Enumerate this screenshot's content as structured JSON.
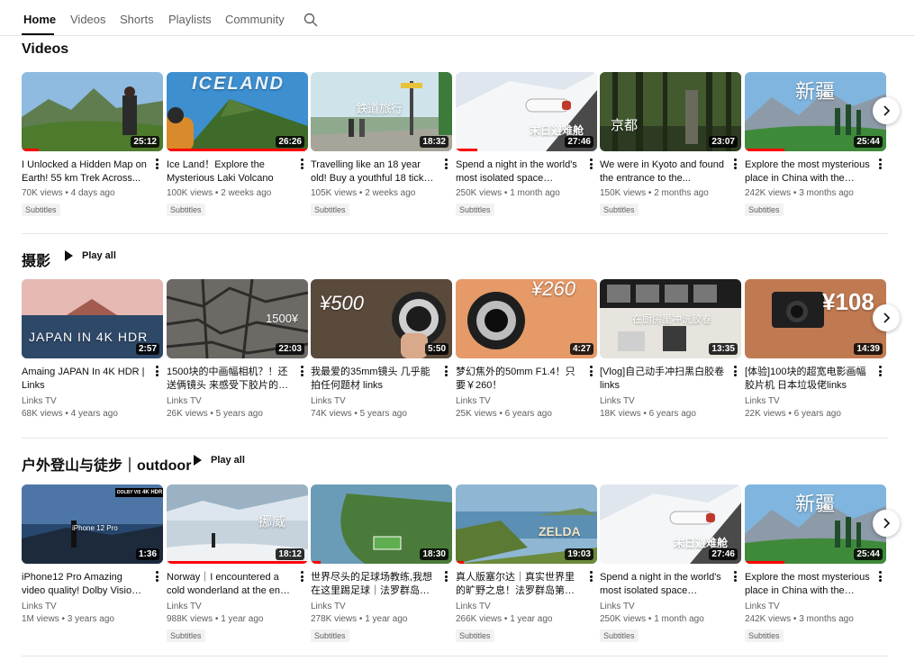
{
  "tabs": [
    {
      "label": "Home",
      "active": true
    },
    {
      "label": "Videos",
      "active": false
    },
    {
      "label": "Shorts",
      "active": false
    },
    {
      "label": "Playlists",
      "active": false
    },
    {
      "label": "Community",
      "active": false
    }
  ],
  "colors": {
    "progress": "#ff0000",
    "text_secondary": "#606060",
    "divider": "#e5e5e5"
  },
  "shelves": [
    {
      "title": "Videos",
      "play_all": "",
      "videos": [
        {
          "title": "I Unlocked a Hidden Map on Earth! 55 km Trek Across...",
          "channel": "",
          "meta": "70K views • 4 days ago",
          "badge": "Subtitles",
          "duration": "25:12",
          "overlay": "",
          "progress": 0.12
        },
        {
          "title": "Ice Land！Explore the Mysterious Laki Volcano",
          "channel": "",
          "meta": "100K views • 2 weeks ago",
          "badge": "Subtitles",
          "duration": "26:26",
          "overlay": "ICELAND",
          "progress": 1.0
        },
        {
          "title": "Travelling like an 18 year old! Buy a youthful 18 ticket and...",
          "channel": "",
          "meta": "105K views • 2 weeks ago",
          "badge": "Subtitles",
          "duration": "18:32",
          "overlay": "鉄道旅行",
          "progress": 0
        },
        {
          "title": "Spend a night in the world's most isolated space capsul...",
          "channel": "",
          "meta": "250K views • 1 month ago",
          "badge": "Subtitles",
          "duration": "27:46",
          "overlay": "末日避难舱",
          "progress": 0.15
        },
        {
          "title": "We were in Kyoto and found the entrance to the...",
          "channel": "",
          "meta": "150K views • 2 months ago",
          "badge": "Subtitles",
          "duration": "23:07",
          "overlay": "京都",
          "progress": 0
        },
        {
          "title": "Explore the most mysterious place in China with the New...",
          "channel": "",
          "meta": "242K views • 3 months ago",
          "badge": "Subtitles",
          "duration": "25:44",
          "overlay": "新疆",
          "progress": 0.28
        }
      ]
    },
    {
      "title": "摄影",
      "play_all": "Play all",
      "videos": [
        {
          "title": "Amaing JAPAN In 4K HDR | Links",
          "channel": "Links TV",
          "meta": "68K views • 4 years ago",
          "badge": "",
          "duration": "2:57",
          "overlay": "JAPAN IN 4K HDR",
          "progress": 0
        },
        {
          "title": "1500块的中画幅相机？！还送俩镜头 来感受下胶片的魅...",
          "channel": "Links TV",
          "meta": "26K views • 5 years ago",
          "badge": "",
          "duration": "22:03",
          "overlay": "1500¥",
          "progress": 0
        },
        {
          "title": "我最爱的35mm镜头 几乎能拍任何题材 links",
          "channel": "Links TV",
          "meta": "74K views • 5 years ago",
          "badge": "",
          "duration": "5:50",
          "overlay": "¥500",
          "progress": 0
        },
        {
          "title": "梦幻焦外的50mm F1.4！只要￥260！",
          "channel": "Links TV",
          "meta": "25K views • 6 years ago",
          "badge": "",
          "duration": "4:27",
          "overlay": "¥260",
          "progress": 0
        },
        {
          "title": "[Vlog]自己动手冲扫黑白胶卷 links",
          "channel": "Links TV",
          "meta": "18K views • 6 years ago",
          "badge": "",
          "duration": "13:35",
          "overlay": "在厨房里冲洗胶卷",
          "progress": 0
        },
        {
          "title": "[体验]100块的超宽电影画幅胶片机 日本垃圾佬links",
          "channel": "Links TV",
          "meta": "22K views • 6 years ago",
          "badge": "",
          "duration": "14:39",
          "overlay": "¥108",
          "progress": 0
        }
      ]
    },
    {
      "title": "户外登山与徒步｜outdoor",
      "play_all": "Play all",
      "videos": [
        {
          "title": "iPhone12 Pro Amazing video quality! Dolby Vision 4K...",
          "channel": "Links TV",
          "meta": "1M views • 3 years ago",
          "badge": "",
          "duration": "1:36",
          "overlay": "iPhone 12 Pro",
          "progress": 0
        },
        {
          "title": "Norway｜I encountered a cold wonderland at the end ...",
          "channel": "Links TV",
          "meta": "988K views • 1 year ago",
          "badge": "Subtitles",
          "duration": "18:12",
          "overlay": "挪威",
          "progress": 1.0
        },
        {
          "title": "世界尽头的足球场教练,我想在这里踢足球｜法罗群岛｜...",
          "channel": "Links TV",
          "meta": "278K views • 1 year ago",
          "badge": "Subtitles",
          "duration": "18:30",
          "overlay": "",
          "progress": 0.07
        },
        {
          "title": "真人版塞尔达｜真实世界里的旷野之息！法罗群岛第三集...",
          "channel": "Links TV",
          "meta": "266K views • 1 year ago",
          "badge": "Subtitles",
          "duration": "19:03",
          "overlay": "ZELDA",
          "progress": 0.06
        },
        {
          "title": "Spend a night in the world's most isolated space capsul...",
          "channel": "Links TV",
          "meta": "250K views • 1 month ago",
          "badge": "Subtitles",
          "duration": "27:46",
          "overlay": "末日避难舱",
          "progress": 0
        },
        {
          "title": "Explore the most mysterious place in China with the New...",
          "channel": "Links TV",
          "meta": "242K views • 3 months ago",
          "badge": "Subtitles",
          "duration": "25:44",
          "overlay": "新疆",
          "progress": 0.28
        }
      ]
    }
  ],
  "row3_badges": {
    "dolby": "DOLBY VISION",
    "hdr": "4K HDR"
  }
}
